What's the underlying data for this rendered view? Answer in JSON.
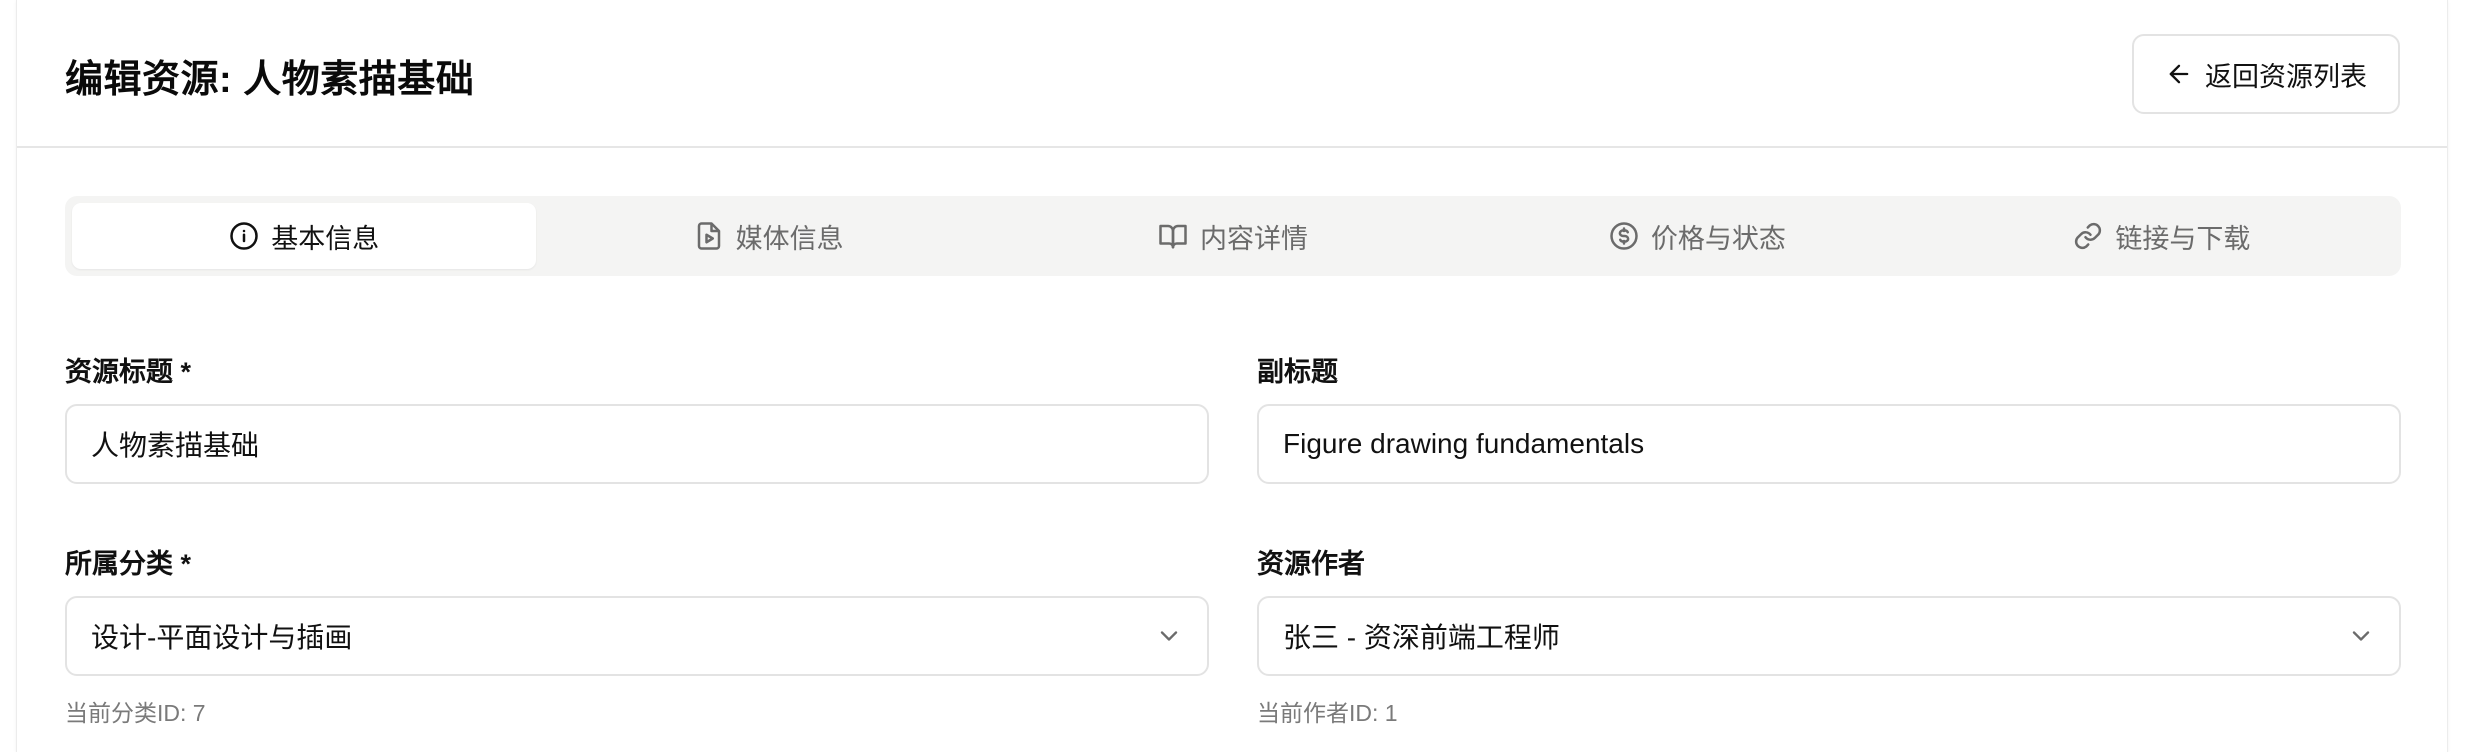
{
  "header": {
    "title": "编辑资源: 人物素描基础",
    "back_label": "返回资源列表"
  },
  "tabs": [
    {
      "label": "基本信息",
      "icon": "info-icon",
      "active": true
    },
    {
      "label": "媒体信息",
      "icon": "file-play-icon",
      "active": false
    },
    {
      "label": "内容详情",
      "icon": "book-open-icon",
      "active": false
    },
    {
      "label": "价格与状态",
      "icon": "dollar-circle-icon",
      "active": false
    },
    {
      "label": "链接与下载",
      "icon": "link-icon",
      "active": false
    }
  ],
  "form": {
    "title": {
      "label": "资源标题 *",
      "value": "人物素描基础"
    },
    "subtitle": {
      "label": "副标题",
      "value": "Figure drawing fundamentals"
    },
    "category": {
      "label": "所属分类 *",
      "value": "设计-平面设计与插画",
      "hint": "当前分类ID: 7"
    },
    "author": {
      "label": "资源作者",
      "value": "张三 - 资深前端工程师",
      "hint": "当前作者ID: 1"
    }
  },
  "colors": {
    "border": "#e3e3e3",
    "tab_bg": "#f4f4f3",
    "muted_text": "#6b6b6b"
  }
}
